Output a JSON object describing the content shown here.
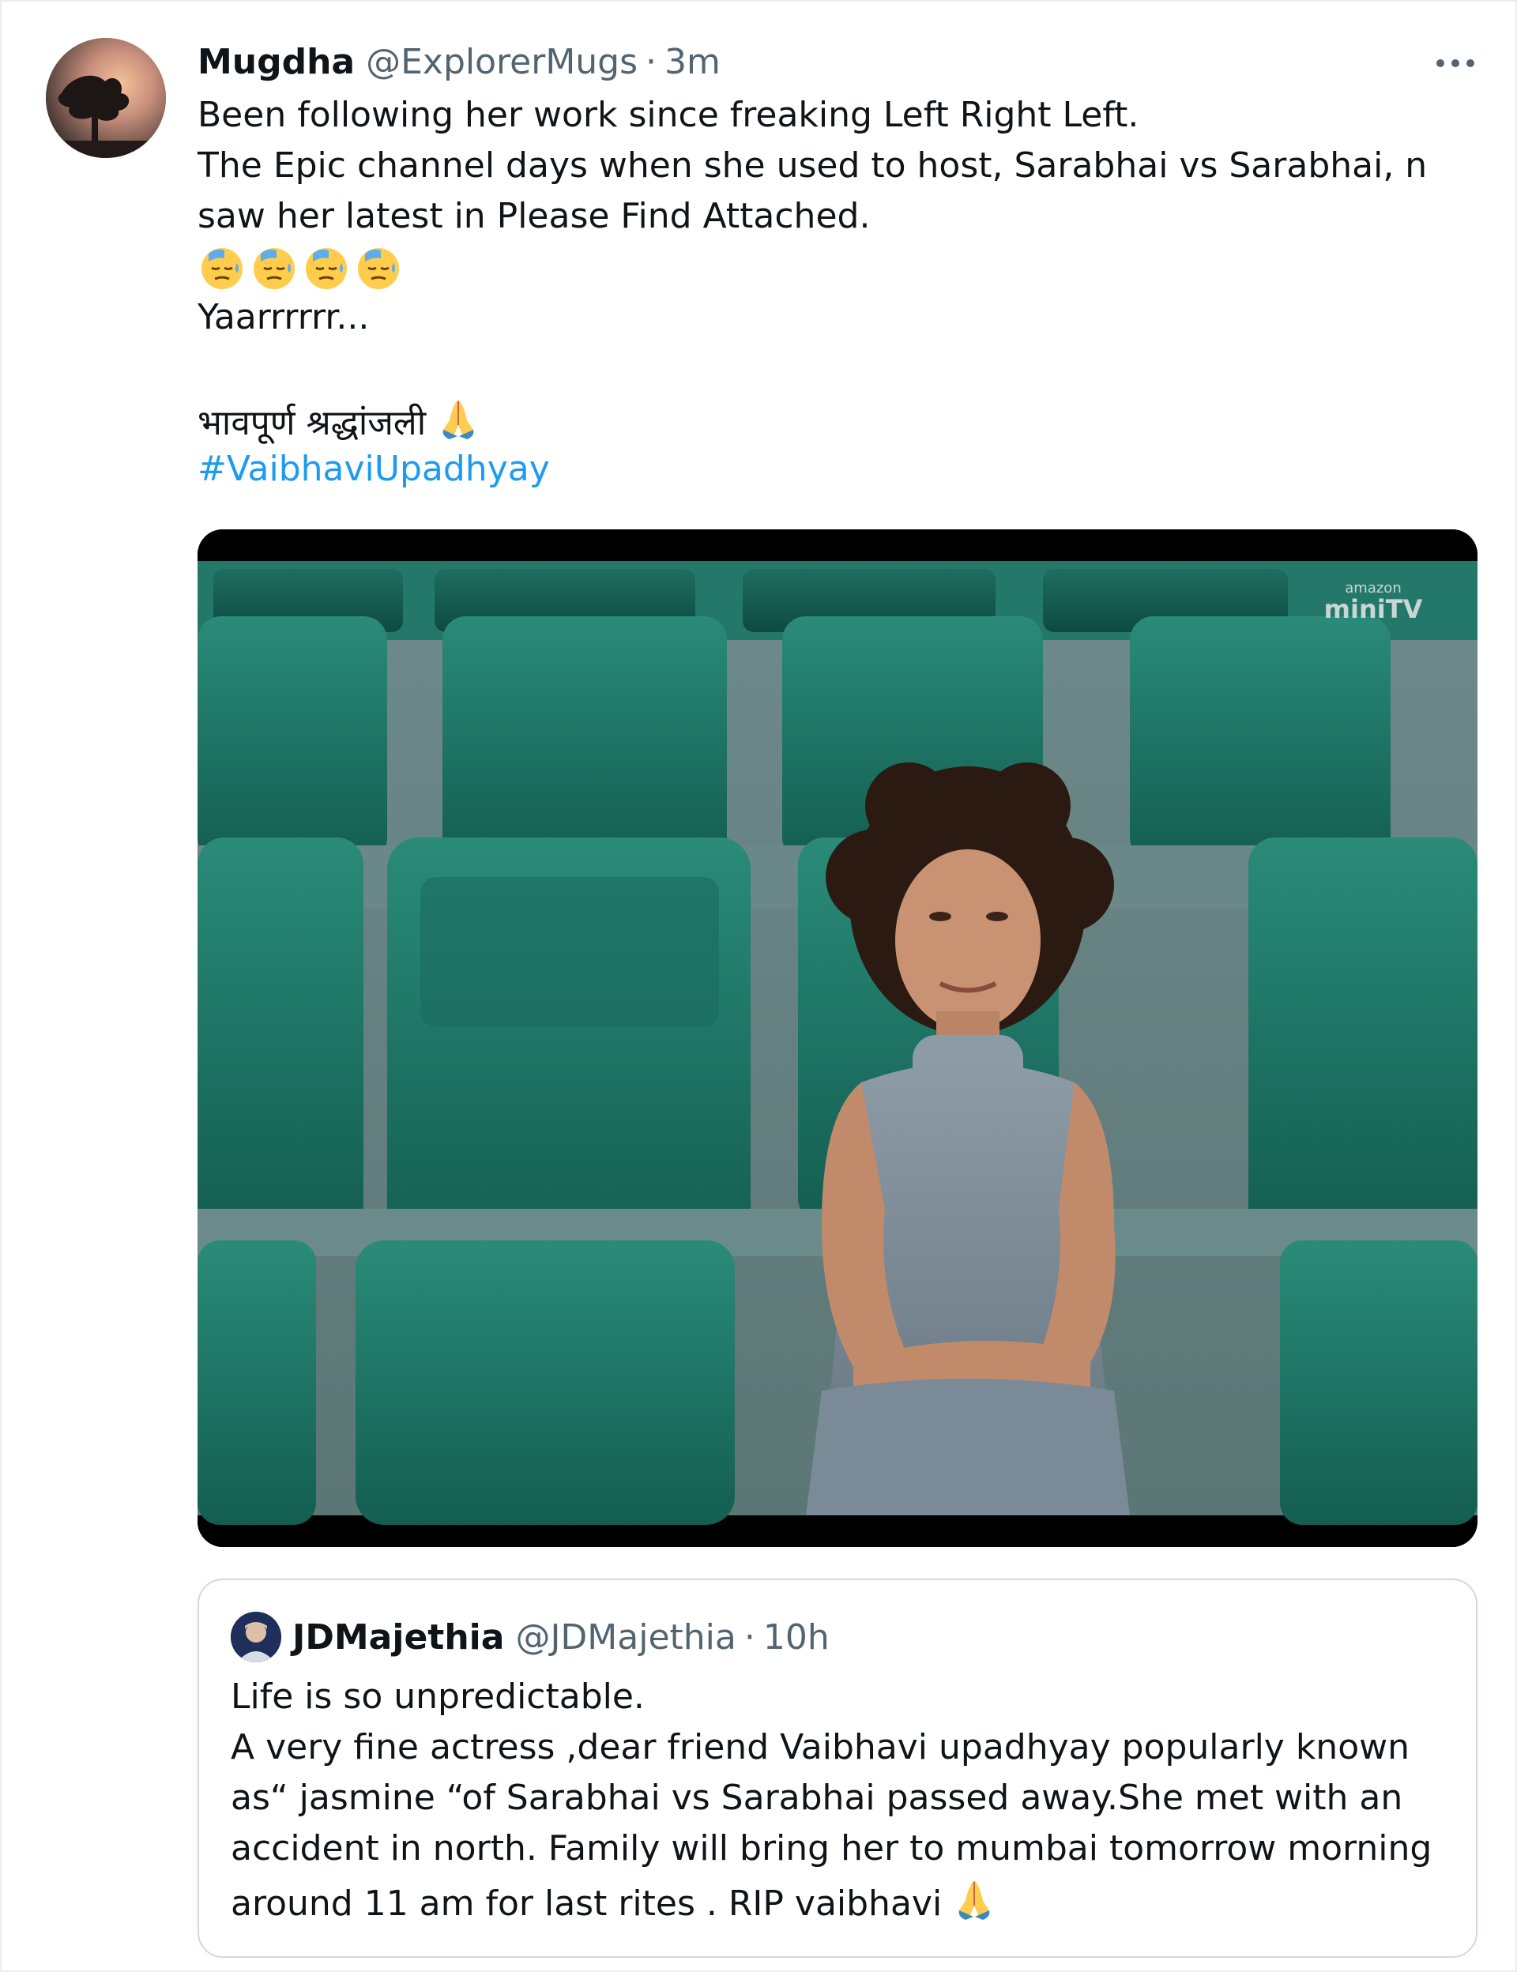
{
  "tweet": {
    "display_name": "Mugdha",
    "handle": "@ExplorerMugs",
    "separator": "·",
    "time": "3m",
    "more_icon": "more-horizontal-icon",
    "lines": [
      "Been following her work since freaking Left Right Left.",
      "The Epic channel days when she used to host, Sarabhai vs Sarabhai, n",
      "saw her latest in Please Find Attached."
    ],
    "emoji_row": [
      "downcast-sweat-face-emoji",
      "downcast-sweat-face-emoji",
      "downcast-sweat-face-emoji",
      "downcast-sweat-face-emoji"
    ],
    "line_after_emoji": "Yaarrrrrr...",
    "hindi_line": "भावपूर्ण श्रद्धांजली",
    "hindi_emoji": "folded-hands-emoji",
    "hashtag": "#VaibhaviUpadhyay",
    "media": {
      "watermark_top": "amazon",
      "watermark_bottom": "miniTV"
    }
  },
  "quoted_tweet": {
    "display_name": "JDMajethia",
    "handle": "@JDMajethia",
    "separator": "·",
    "time": "10h",
    "lines": [
      "Life is so unpredictable.",
      "A very fine actress ,dear friend Vaibhavi upadhyay popularly known",
      "as“ jasmine “of Sarabhai vs Sarabhai passed away.She met with an",
      "accident in north. Family will bring her to mumbai tomorrow morning"
    ],
    "last_line": "around 11 am for last rites . RIP vaibhavi",
    "last_emoji": "folded-hands-emoji"
  },
  "colors": {
    "text": "#0f1419",
    "muted": "#536471",
    "link": "#1d9bf0",
    "border": "#cfd9de",
    "seat_green": "#1f7a6a"
  }
}
